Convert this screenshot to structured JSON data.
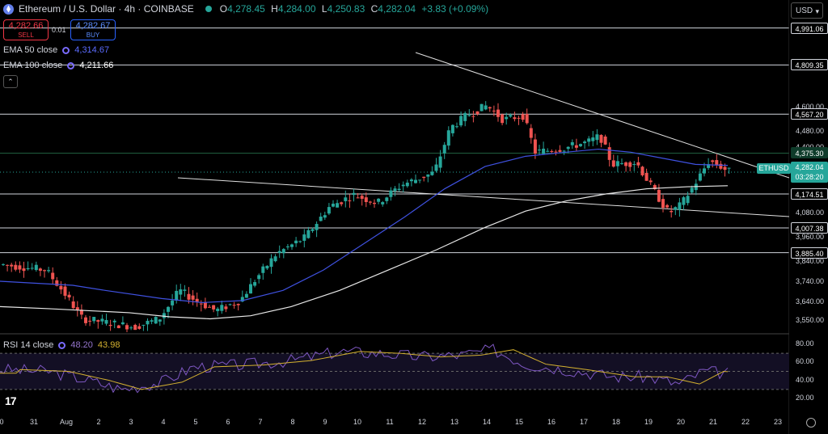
{
  "header": {
    "symbol_title": "Ethereum / U.S. Dollar · 4h · COINBASE",
    "ohlc": {
      "o_label": "O",
      "o": "4,278.45",
      "h_label": "H",
      "h": "4,284.00",
      "l_label": "L",
      "l": "4,250.83",
      "c_label": "C",
      "c": "4,282.04",
      "change": "+3.83 (+0.09%)"
    }
  },
  "trade": {
    "sell_price": "4,282.66",
    "sell_label": "SELL",
    "spread": "0.01",
    "buy_price": "4,282.67",
    "buy_label": "BUY"
  },
  "indicators": {
    "ema50": {
      "label": "EMA 50 close",
      "value": "4,314.67",
      "color": "#3f51e0"
    },
    "ema100": {
      "label": "EMA 100 close",
      "value": "4,211.66",
      "color": "#e8e8e8"
    },
    "rsi": {
      "label": "RSI 14 close",
      "value1": "48.20",
      "value2": "43.98",
      "color1": "#7e57c2",
      "color2": "#d4b130"
    }
  },
  "currency_button": "USD",
  "price_axis": {
    "ticks": [
      "4,600.00",
      "4,480.00",
      "4,400.00",
      "4,280.00",
      "4,080.00",
      "3,960.00",
      "3,840.00",
      "3,740.00",
      "3,640.00",
      "3,550.00"
    ],
    "levels": [
      "4,991.06",
      "4,809.35",
      "4,567.20",
      "4,375.30",
      "4,174.51",
      "4,007.38",
      "3,885.40"
    ],
    "current": {
      "symbol": "ETHUSD",
      "price": "4,282.04",
      "countdown": "03:28:20"
    }
  },
  "rsi_axis": {
    "ticks": [
      "80.00",
      "60.00",
      "40.00",
      "20.00"
    ]
  },
  "time_axis": {
    "labels": [
      "0",
      "31",
      "Aug",
      "2",
      "3",
      "4",
      "5",
      "6",
      "7",
      "8",
      "9",
      "10",
      "11",
      "12",
      "13",
      "14",
      "15",
      "16",
      "17",
      "18",
      "19",
      "20",
      "21",
      "22",
      "23"
    ]
  },
  "colors": {
    "up": "#26a69a",
    "down": "#ef5350",
    "background": "#000000"
  }
}
